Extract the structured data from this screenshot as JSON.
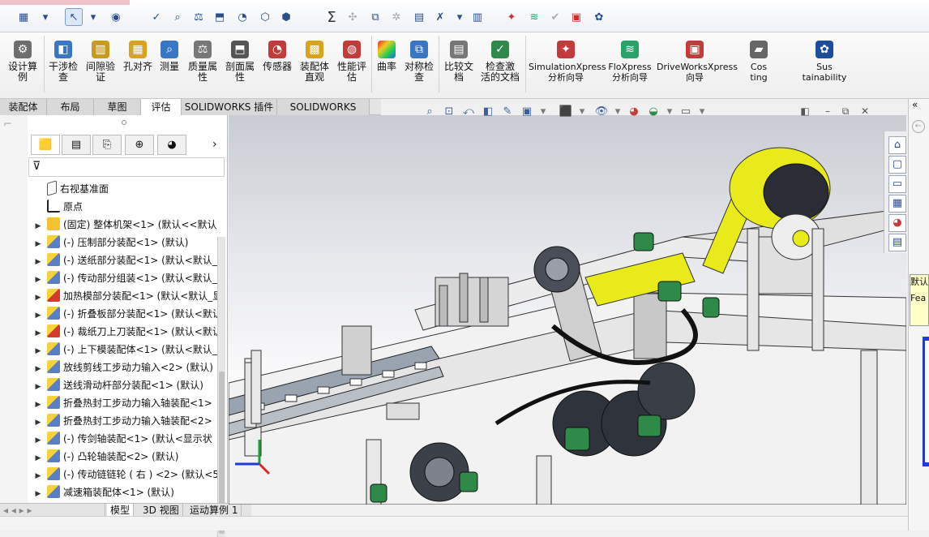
{
  "app": {
    "brand": "SOLIDWORKS",
    "colors": {
      "accent": "#c8102e",
      "ribbon_bg": "#f6f6f6",
      "tab_active": "#ffffff",
      "part_yellow": "#e8ea1a",
      "part_green": "#2f8a4a"
    }
  },
  "quick_access": {
    "icons": [
      "grid-icon",
      "cursor-icon",
      "appearance-icon",
      "spelling-icon",
      "measure-icon",
      "mass-icon",
      "sensor-icon",
      "check-icon",
      "sum-icon",
      "clearance-icon",
      "symmetry-icon",
      "compare-icon",
      "activate-icon",
      "cost-icon",
      "sustain-icon",
      "check-disabled-icon",
      "drive-icon",
      "settings-icon"
    ]
  },
  "ribbon": {
    "buttons": [
      {
        "label": "设计算例",
        "icon": "design-study-icon"
      },
      {
        "label": "干涉检查",
        "icon": "interference-icon"
      },
      {
        "label": "间隙验证",
        "icon": "clearance-icon"
      },
      {
        "label": "孔对齐",
        "icon": "hole-align-icon"
      },
      {
        "label": "测量",
        "icon": "measure-icon"
      },
      {
        "label": "质量属性",
        "icon": "mass-properties-icon"
      },
      {
        "label": "剖面属性",
        "icon": "section-properties-icon"
      },
      {
        "label": "传感器",
        "icon": "sensor-icon"
      },
      {
        "label": "装配体直观",
        "icon": "assembly-visualization-icon"
      },
      {
        "label": "性能评估",
        "icon": "performance-icon"
      },
      {
        "label": "曲率",
        "icon": "curvature-icon"
      },
      {
        "label": "对称检查",
        "icon": "symmetry-check-icon"
      },
      {
        "label": "比较文档",
        "icon": "compare-icon"
      },
      {
        "label": "检查激活的文档",
        "icon": "check-active-icon"
      },
      {
        "label": "SimulationXpress 分析向导",
        "icon": "simulationxpress-icon"
      },
      {
        "label": "FloXpress 分析向导",
        "icon": "floxpress-icon"
      },
      {
        "label": "DriveWorksXpress 向导",
        "icon": "driveworks-icon"
      },
      {
        "label": "Costing",
        "icon": "costing-icon"
      },
      {
        "label": "Sustainability",
        "icon": "sustainability-icon"
      }
    ]
  },
  "command_tabs": [
    {
      "label": "装配体",
      "active": false
    },
    {
      "label": "布局",
      "active": false
    },
    {
      "label": "草图",
      "active": false
    },
    {
      "label": "评估",
      "active": true
    },
    {
      "label": "SOLIDWORKS 插件",
      "active": false
    },
    {
      "label": "SOLIDWORKS MBD",
      "active": false
    }
  ],
  "feature_manager": {
    "tree": [
      {
        "text": "右视基准面",
        "icon": "plane-icon",
        "expandable": false
      },
      {
        "text": "原点",
        "icon": "origin-icon",
        "expandable": false
      },
      {
        "text": "(固定) 整体机架<1> (默认<<默认",
        "icon": "part-icon",
        "expandable": true
      },
      {
        "text": "(-) 压制部分装配<1> (默认)",
        "icon": "assembly-icon",
        "expandable": true
      },
      {
        "text": "(-) 送纸部分装配<1> (默认<默认_",
        "icon": "assembly-icon",
        "expandable": true
      },
      {
        "text": "(-) 传动部分组装<1> (默认<默认_",
        "icon": "assembly-icon",
        "expandable": true
      },
      {
        "text": "加热模部分装配<1> (默认<默认_显",
        "icon": "assembly-warning-icon",
        "expandable": true
      },
      {
        "text": "(-) 折叠板部分装配<1> (默认<默认",
        "icon": "assembly-icon",
        "expandable": true
      },
      {
        "text": "(-) 裁纸刀上刀装配<1> (默认<默认",
        "icon": "assembly-warning-icon",
        "expandable": true
      },
      {
        "text": "(-) 上下模装配体<1> (默认<默认_",
        "icon": "assembly-icon",
        "expandable": true
      },
      {
        "text": "放线剪线工步动力输入<2> (默认)",
        "icon": "assembly-icon",
        "expandable": true
      },
      {
        "text": "送线滑动杆部分装配<1> (默认)",
        "icon": "assembly-icon",
        "expandable": true
      },
      {
        "text": "折叠热封工步动力输入轴装配<1>",
        "icon": "assembly-icon",
        "expandable": true
      },
      {
        "text": "折叠热封工步动力输入轴装配<2>",
        "icon": "assembly-icon",
        "expandable": true
      },
      {
        "text": "(-) 传剑轴装配<1> (默认<显示状",
        "icon": "assembly-icon",
        "expandable": true
      },
      {
        "text": "(-) 凸轮轴装配<2> (默认)",
        "icon": "assembly-icon",
        "expandable": true
      },
      {
        "text": "(-) 传动链链轮 ( 右 ) <2> (默认<5",
        "icon": "assembly-icon",
        "expandable": true
      },
      {
        "text": "减速箱装配体<1> (默认)",
        "icon": "assembly-icon",
        "expandable": true
      }
    ]
  },
  "bottom_tabs": [
    {
      "label": "模型",
      "active": true
    },
    {
      "label": "3D 视图",
      "active": false
    },
    {
      "label": "运动算例 1",
      "active": false
    }
  ],
  "task_pane": {
    "yellow_note_line1": "默认",
    "yellow_note_line2": "Fea"
  }
}
